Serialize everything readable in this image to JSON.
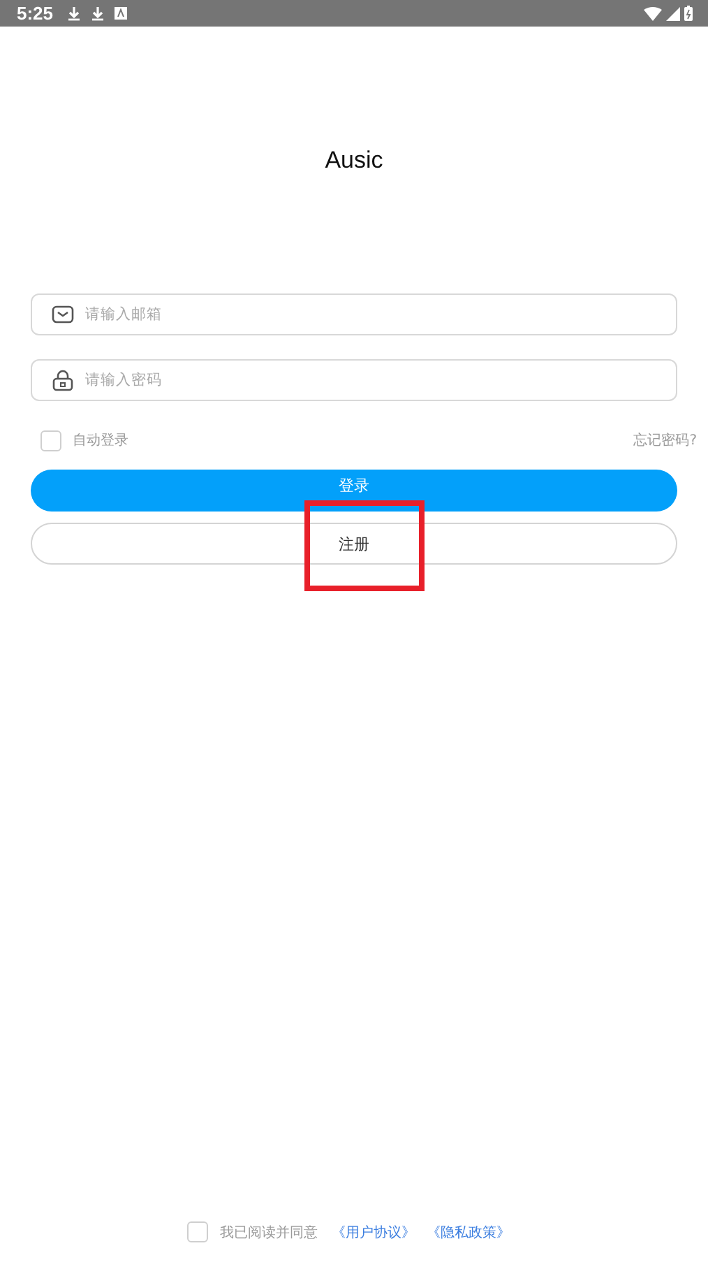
{
  "status_bar": {
    "time": "5:25"
  },
  "app_title": "Ausic",
  "email_field": {
    "placeholder": "请输入邮箱"
  },
  "password_field": {
    "placeholder": "请输入密码"
  },
  "auto_login": {
    "label": "自动登录",
    "checked": false
  },
  "forgot_link": "忘记密码?",
  "login_button": "登录",
  "register_button": "注册",
  "highlight": {
    "color": "#e8202a"
  },
  "agreement": {
    "checked": false,
    "text": "我已阅读并同意",
    "links": [
      "《用户协议》",
      "《隐私政策》"
    ]
  }
}
